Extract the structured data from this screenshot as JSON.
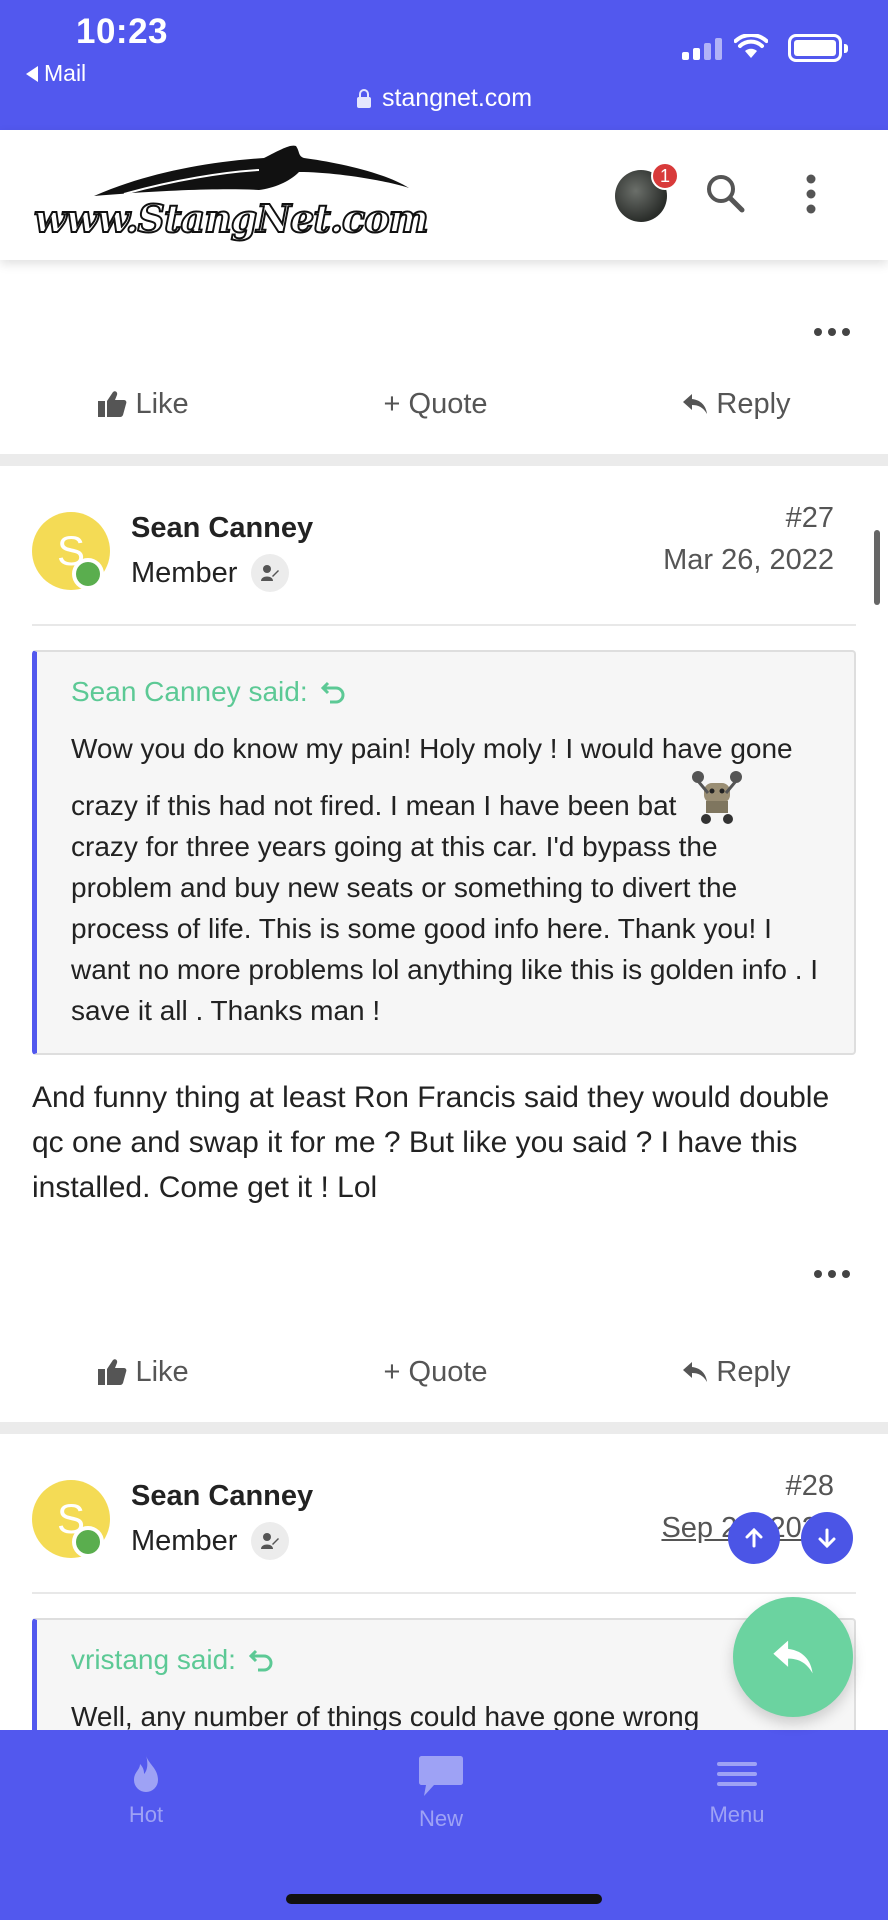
{
  "status_bar": {
    "time": "10:23",
    "back_app": "Mail",
    "url": "stangnet.com"
  },
  "header": {
    "logo_text": "www.StangNet.com",
    "notification_count": "1"
  },
  "actions": {
    "like": "Like",
    "quote": "+ Quote",
    "reply": "Reply"
  },
  "posts": [
    {
      "author": "Sean Canney",
      "avatar_letter": "S",
      "role": "Member",
      "number": "#27",
      "date": "Mar 26, 2022",
      "quote_author": "Sean Canney said:",
      "quote_pre": "Wow you do know my pain! Holy moly ! I would have gone crazy if this had not fired. I mean I have been bat",
      "quote_post": "crazy for three years going at this car. I'd bypass the problem and buy new seats or something to divert the process of life. This is some good info here. Thank you! I want no more problems lol anything like this is golden info . I save it all . Thanks man !",
      "body": "And funny thing at least Ron Francis said they would double qc one and swap it for me ? But like you said ? I have this installed. Come get it ! Lol"
    },
    {
      "author": "Sean Canney",
      "avatar_letter": "S",
      "role": "Member",
      "number": "#28",
      "date": "Sep 24, 2022",
      "quote_author": "vristang said:",
      "quote_pre": "Well, any number of things could have gone wrong"
    }
  ],
  "bottom_nav": {
    "hot": "Hot",
    "new": "New",
    "menu": "Menu"
  },
  "colors": {
    "brand": "#5258ee",
    "quote_author": "#5cc995",
    "fab_reply": "#6bd3a0"
  }
}
